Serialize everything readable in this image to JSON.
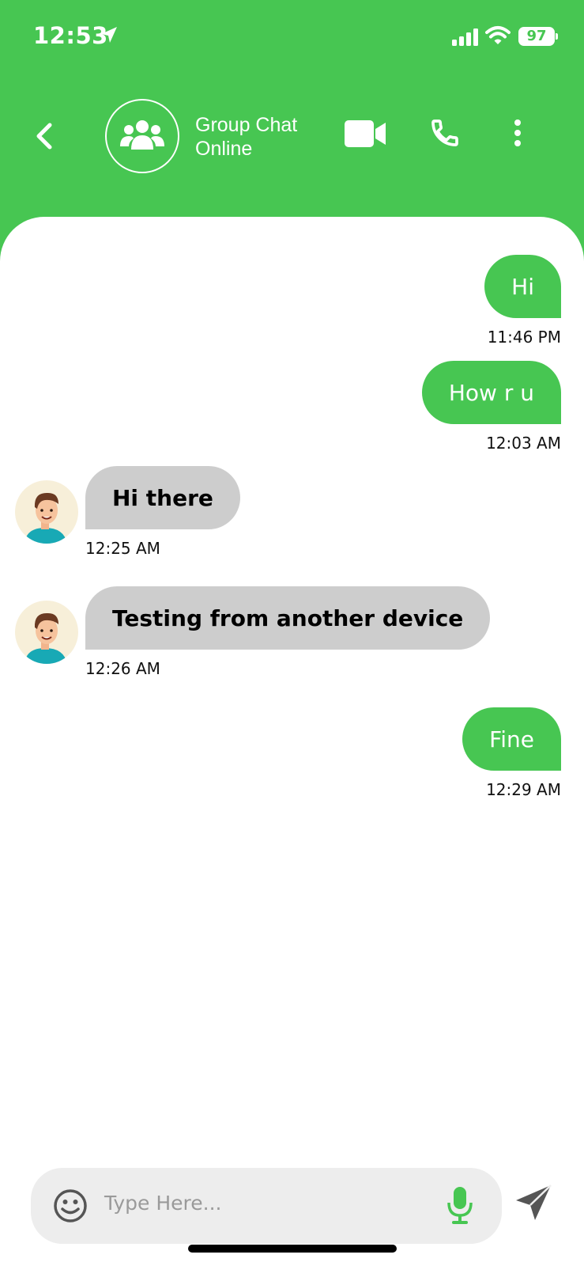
{
  "status_bar": {
    "time": "12:53",
    "battery": "97"
  },
  "header": {
    "title": "Group Chat",
    "status": "Online"
  },
  "messages": [
    {
      "direction": "out",
      "text": "Hi",
      "time": "11:46 PM"
    },
    {
      "direction": "out",
      "text": "How r u",
      "time": "12:03 AM"
    },
    {
      "direction": "in",
      "text": "Hi there",
      "time": "12:25 AM"
    },
    {
      "direction": "in",
      "text": "Testing from another device",
      "time": "12:26 AM"
    },
    {
      "direction": "out",
      "text": "Fine",
      "time": "12:29 AM"
    }
  ],
  "composer": {
    "placeholder": "Type Here..."
  },
  "colors": {
    "accent": "#47C652",
    "incoming_bubble": "#CDCDCD",
    "input_bg": "#EDEDED"
  },
  "icons": [
    "location-arrow-icon",
    "signal-icon",
    "wifi-icon",
    "battery-icon",
    "back-chevron-icon",
    "group-icon",
    "video-call-icon",
    "phone-icon",
    "more-vertical-icon",
    "emoji-icon",
    "microphone-icon",
    "send-icon"
  ]
}
